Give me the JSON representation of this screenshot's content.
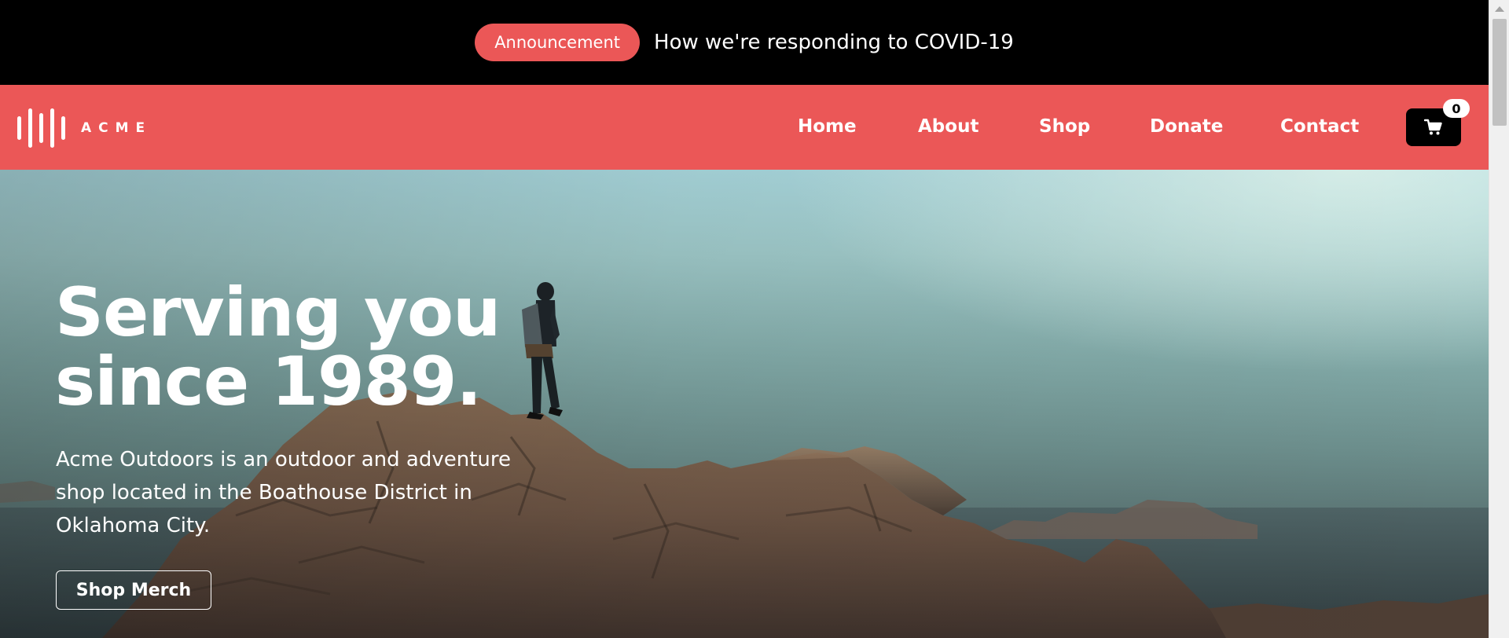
{
  "announcement": {
    "badge": "Announcement",
    "text": "How we're responding to COVID-19"
  },
  "navbar": {
    "logo_text": "ACME",
    "links": [
      "Home",
      "About",
      "Shop",
      "Donate",
      "Contact"
    ],
    "cart_count": "0",
    "cart_icon": "shopping-cart-icon",
    "accent_color": "#eb5757"
  },
  "hero": {
    "title_line1": "Serving you",
    "title_line2": "since 1989.",
    "description": "Acme Outdoors is an outdoor and adventure shop located in the Boathouse District in Oklahoma City.",
    "cta_label": "Shop Merch"
  }
}
